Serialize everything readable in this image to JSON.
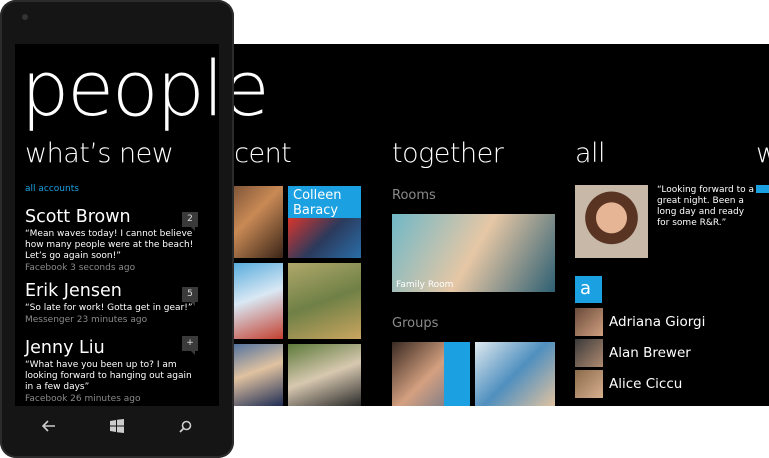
{
  "hub": {
    "title": "people",
    "sections": {
      "whats_new": "what’s new",
      "recent": "recent",
      "together": "together",
      "all": "all",
      "next_peek": "w"
    }
  },
  "recent": {
    "featured_tile_name": "Colleen\nBaracy"
  },
  "together": {
    "rooms_label": "Rooms",
    "room_tile_caption": "Family Room",
    "groups_label": "Groups"
  },
  "all": {
    "profile_quote": "“Looking forward to a great night. Been a long day and ready for some R&R.”",
    "letter": "a",
    "contacts": [
      "Adriana Giorgi",
      "Alan Brewer",
      "Alice Ciccu"
    ]
  },
  "phone": {
    "big_title": "people",
    "section_title": "what’s new",
    "filter": "all accounts",
    "feed": [
      {
        "name": "Scott Brown",
        "message": "“Mean waves today! I cannot believe how many people were at the beach! Let’s go again soon!”",
        "meta": "Facebook 3 seconds ago",
        "badge": "2"
      },
      {
        "name": "Erik Jensen",
        "message": "“So late for work! Gotta get in gear!”",
        "meta": "Messenger 23 minutes ago",
        "badge": "5"
      },
      {
        "name": "Jenny Liu",
        "message": "“What have you been up to? I am looking forward to hanging out again in a few days”",
        "meta": "Facebook 26 minutes ago",
        "badge": "+"
      }
    ]
  },
  "colors": {
    "accent": "#1ba1e2",
    "background": "#000000",
    "subtle": "#8a8a8a"
  },
  "icons": {
    "back": "back-arrow-icon",
    "start": "windows-logo-icon",
    "search": "search-icon"
  }
}
